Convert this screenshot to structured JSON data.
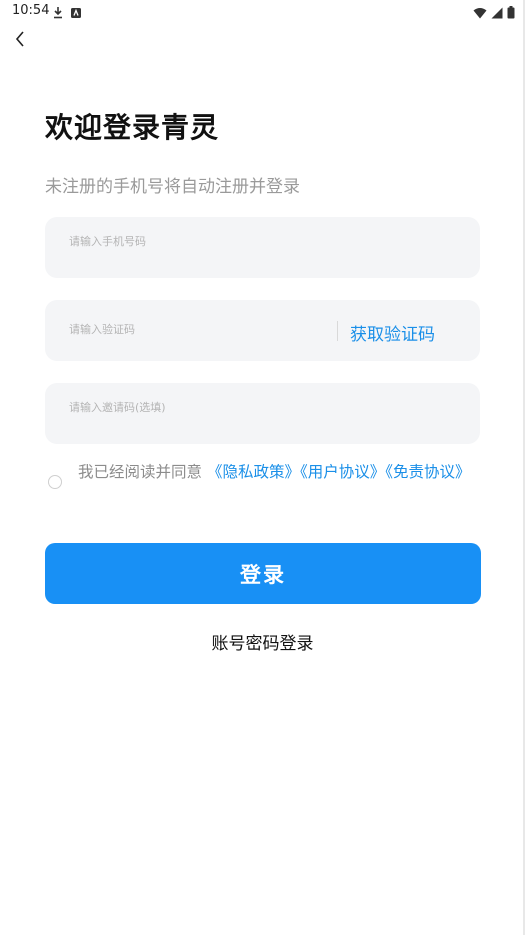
{
  "status_bar": {
    "time": "10:54",
    "icons": [
      "download-icon",
      "app-notification-icon",
      "wifi-icon",
      "signal-icon",
      "battery-icon"
    ]
  },
  "header": {
    "back_icon": "chevron-left-icon"
  },
  "page": {
    "title": "欢迎登录青灵",
    "subtitle": "未注册的手机号将自动注册并登录"
  },
  "form": {
    "phone_placeholder": "请输入手机号码",
    "phone_value": "",
    "code_placeholder": "请输入验证码",
    "code_value": "",
    "get_code_label": "获取验证码",
    "invite_placeholder": "请输入邀请码(选填)",
    "invite_value": ""
  },
  "agreement": {
    "checked": false,
    "prefix": "我已经阅读并同意",
    "privacy_link": "《隐私政策》",
    "user_link": "《用户协议》",
    "disclaimer_link": "《免责协议》"
  },
  "actions": {
    "login_label": "登录",
    "password_login_label": "账号密码登录"
  },
  "colors": {
    "accent": "#1890f5",
    "link": "#1a8fe8",
    "input_bg": "#f4f5f7"
  }
}
